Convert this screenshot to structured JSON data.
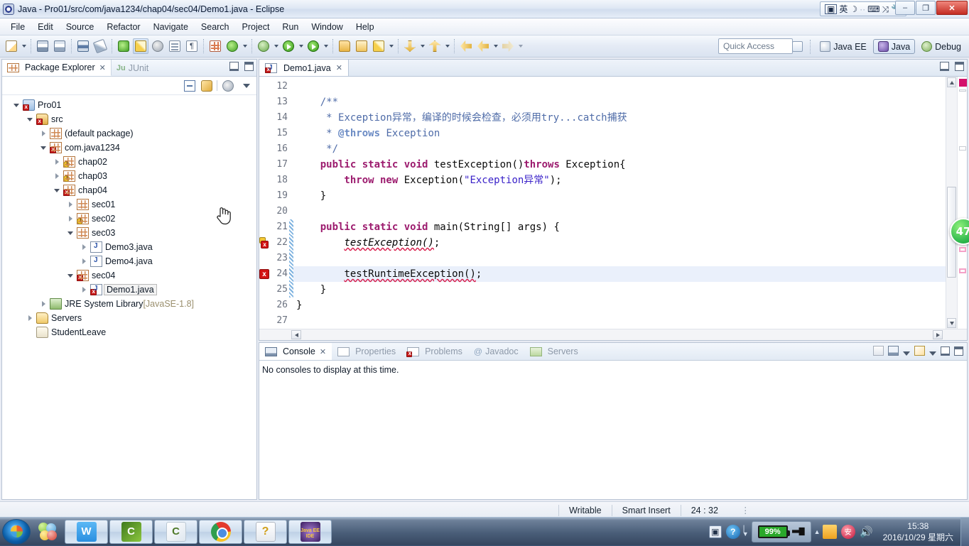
{
  "window": {
    "title": "Java - Pro01/src/com/java1234/chap04/sec04/Demo1.java - Eclipse",
    "app_icon": "eclipse-icon",
    "minimize_label": "–",
    "maximize_label": "❐",
    "close_label": "✕"
  },
  "ime": {
    "icon": "ime-logo-icon",
    "mode": "英",
    "moon": "☽",
    "dots": "··",
    "keyboard": "⌨",
    "tools": "⤨",
    "wrench": "🔧"
  },
  "menubar": {
    "items": [
      "File",
      "Edit",
      "Source",
      "Refactor",
      "Navigate",
      "Search",
      "Project",
      "Run",
      "Window",
      "Help"
    ]
  },
  "toolbar": {
    "quick_access_placeholder": "Quick Access",
    "perspectives": [
      {
        "label": "Java EE",
        "icon": "java-ee-perspective-icon",
        "active": false
      },
      {
        "label": "Java",
        "icon": "java-perspective-icon",
        "active": true
      },
      {
        "label": "Debug",
        "icon": "debug-perspective-icon",
        "active": false
      }
    ],
    "new_perspective_icon": "open-perspective-icon"
  },
  "package_explorer": {
    "tab_label": "Package Explorer",
    "tab_close": "✕",
    "junit_tab_label": "JUnit",
    "junit_icon_text": "Ju",
    "minimize": "minimize-icon",
    "maximize": "maximize-icon",
    "tools": [
      "collapse-all-icon",
      "link-with-editor-icon",
      "view-menu-icon"
    ],
    "tree": [
      {
        "label": "Pro01",
        "indent": 0,
        "twisty": "open",
        "icon": "project-icon",
        "decorator": "error",
        "selected": false
      },
      {
        "label": "src",
        "indent": 1,
        "twisty": "open",
        "icon": "source-folder-icon",
        "decorator": "error",
        "selected": false
      },
      {
        "label": "(default package)",
        "indent": 2,
        "twisty": "closed",
        "icon": "package-icon",
        "decorator": "none",
        "selected": false
      },
      {
        "label": "com.java1234",
        "indent": 2,
        "twisty": "open",
        "icon": "package-icon",
        "decorator": "error",
        "selected": false
      },
      {
        "label": "chap02",
        "indent": 3,
        "twisty": "closed",
        "icon": "package-icon",
        "decorator": "warning",
        "selected": false
      },
      {
        "label": "chap03",
        "indent": 3,
        "twisty": "closed",
        "icon": "package-icon",
        "decorator": "warning",
        "selected": false
      },
      {
        "label": "chap04",
        "indent": 3,
        "twisty": "open",
        "icon": "package-icon",
        "decorator": "error",
        "selected": false
      },
      {
        "label": "sec01",
        "indent": 4,
        "twisty": "closed",
        "icon": "package-icon",
        "decorator": "none",
        "selected": false
      },
      {
        "label": "sec02",
        "indent": 4,
        "twisty": "closed",
        "icon": "package-icon",
        "decorator": "warning",
        "selected": false
      },
      {
        "label": "sec03",
        "indent": 4,
        "twisty": "open",
        "icon": "package-icon",
        "decorator": "none",
        "selected": false
      },
      {
        "label": "Demo3.java",
        "indent": 5,
        "twisty": "closed",
        "icon": "java-file-icon",
        "decorator": "none",
        "selected": false
      },
      {
        "label": "Demo4.java",
        "indent": 5,
        "twisty": "closed",
        "icon": "java-file-icon",
        "decorator": "none",
        "selected": false
      },
      {
        "label": "sec04",
        "indent": 4,
        "twisty": "open",
        "icon": "package-icon",
        "decorator": "error",
        "selected": false
      },
      {
        "label": "Demo1.java",
        "indent": 5,
        "twisty": "closed",
        "icon": "java-file-icon",
        "decorator": "error",
        "selected": true
      },
      {
        "label": "JRE System Library",
        "suffix": "[JavaSE-1.8]",
        "indent": 2,
        "twisty": "closed",
        "icon": "jre-library-icon",
        "decorator": "none",
        "selected": false
      },
      {
        "label": "Servers",
        "indent": 1,
        "twisty": "closed",
        "icon": "servers-folder-icon",
        "decorator": "none",
        "selected": false
      },
      {
        "label": "StudentLeave",
        "indent": 1,
        "twisty": "none",
        "icon": "folder-icon",
        "decorator": "none",
        "selected": false
      }
    ]
  },
  "editor": {
    "tab_label": "Demo1.java",
    "tab_icon": "java-file-error-icon",
    "tab_close": "✕",
    "first_line_number": 12,
    "lines": [
      {
        "n": 12,
        "fold": false,
        "marker": "none",
        "change": false,
        "current": false,
        "tokens": []
      },
      {
        "n": 13,
        "fold": true,
        "marker": "none",
        "change": false,
        "current": false,
        "tokens": [
          {
            "t": "    /**",
            "c": "cm"
          }
        ]
      },
      {
        "n": 14,
        "fold": false,
        "marker": "none",
        "change": false,
        "current": false,
        "tokens": [
          {
            "t": "     * ",
            "c": "cm"
          },
          {
            "t": "Exception异常，编译的时候会检查，必须用try...catch捕获",
            "c": "cm"
          }
        ]
      },
      {
        "n": 15,
        "fold": false,
        "marker": "none",
        "change": false,
        "current": false,
        "tokens": [
          {
            "t": "     * ",
            "c": "cm"
          },
          {
            "t": "@throws",
            "c": "cmtag"
          },
          {
            "t": " Exception",
            "c": "cm"
          }
        ]
      },
      {
        "n": 16,
        "fold": false,
        "marker": "none",
        "change": false,
        "current": false,
        "tokens": [
          {
            "t": "     */",
            "c": "cm"
          }
        ]
      },
      {
        "n": 17,
        "fold": true,
        "marker": "none",
        "change": false,
        "current": false,
        "tokens": [
          {
            "t": "    public static void",
            "c": "kw"
          },
          {
            "t": " testException()",
            "c": "plain"
          },
          {
            "t": "throws",
            "c": "kw"
          },
          {
            "t": " Exception{",
            "c": "plain"
          }
        ]
      },
      {
        "n": 18,
        "fold": false,
        "marker": "none",
        "change": false,
        "current": false,
        "tokens": [
          {
            "t": "        throw new",
            "c": "kw"
          },
          {
            "t": " Exception(",
            "c": "plain"
          },
          {
            "t": "\"Exception异常\"",
            "c": "str"
          },
          {
            "t": ");",
            "c": "plain"
          }
        ]
      },
      {
        "n": 19,
        "fold": false,
        "marker": "none",
        "change": false,
        "current": false,
        "tokens": [
          {
            "t": "    }",
            "c": "plain"
          }
        ]
      },
      {
        "n": 20,
        "fold": false,
        "marker": "none",
        "change": false,
        "current": false,
        "tokens": []
      },
      {
        "n": 21,
        "fold": true,
        "marker": "none",
        "change": true,
        "current": false,
        "tokens": [
          {
            "t": "    public static void",
            "c": "kw"
          },
          {
            "t": " main(String[] args) {",
            "c": "plain"
          }
        ]
      },
      {
        "n": 22,
        "fold": false,
        "marker": "error-warn",
        "change": true,
        "current": false,
        "tokens": [
          {
            "t": "        ",
            "c": "plain"
          },
          {
            "t": "testException()",
            "c": "italic-mth underline-err"
          },
          {
            "t": ";",
            "c": "plain"
          }
        ]
      },
      {
        "n": 23,
        "fold": false,
        "marker": "none",
        "change": true,
        "current": false,
        "tokens": []
      },
      {
        "n": 24,
        "fold": false,
        "marker": "error",
        "change": true,
        "current": true,
        "tokens": [
          {
            "t": "        ",
            "c": "plain"
          },
          {
            "t": "testRuntimeException()",
            "c": "plain underline-err"
          },
          {
            "t": ";",
            "c": "plain"
          }
        ]
      },
      {
        "n": 25,
        "fold": false,
        "marker": "none",
        "change": true,
        "current": false,
        "tokens": [
          {
            "t": "    }",
            "c": "plain"
          }
        ]
      },
      {
        "n": 26,
        "fold": false,
        "marker": "none",
        "change": false,
        "current": false,
        "tokens": [
          {
            "t": "}",
            "c": "plain"
          }
        ]
      },
      {
        "n": 27,
        "fold": false,
        "marker": "none",
        "change": false,
        "current": false,
        "tokens": []
      }
    ],
    "overview_badge": "47"
  },
  "console": {
    "tabs": [
      {
        "label": "Console",
        "icon": "console-icon",
        "active": true,
        "close": "✕"
      },
      {
        "label": "Properties",
        "icon": "properties-icon",
        "active": false
      },
      {
        "label": "Problems",
        "icon": "problems-icon",
        "active": false
      },
      {
        "label": "Javadoc",
        "icon": "javadoc-icon",
        "active": false
      },
      {
        "label": "Servers",
        "icon": "servers-icon",
        "active": false
      }
    ],
    "message": "No consoles to display at this time.",
    "tools": [
      "new-console-view-icon",
      "display-selected-console-icon",
      "open-console-icon",
      "minimize-icon",
      "maximize-icon"
    ]
  },
  "statusbar": {
    "writable": "Writable",
    "insert_mode": "Smart Insert",
    "position": "24 : 32",
    "dots": "⋮"
  },
  "taskbar": {
    "start": "start-orb-icon",
    "quicklaunch": "show-desktop-gadget-icon",
    "buttons": [
      {
        "icon": "wps-writer-icon",
        "glyph": "W"
      },
      {
        "icon": "eclipse-green-icon",
        "glyph": "C"
      },
      {
        "icon": "eclipse-white-icon",
        "glyph": "C"
      },
      {
        "icon": "chrome-icon",
        "glyph": ""
      },
      {
        "icon": "help-document-icon",
        "glyph": "?"
      },
      {
        "icon": "java-ee-ide-icon",
        "glyph": "Java EE IDE"
      }
    ],
    "tray": {
      "ime_icon": "ime-tray-icon",
      "help_icon": "help-tray-icon",
      "expand_icon": "show-hidden-icons-icon",
      "battery_percent": "99%",
      "plug_icon": "power-plug-icon",
      "cart_icon": "shopping-cart-icon",
      "red_icon": "security-tray-icon",
      "speaker_icon": "volume-icon",
      "time": "15:38",
      "date": "2016/10/29 星期六"
    }
  }
}
